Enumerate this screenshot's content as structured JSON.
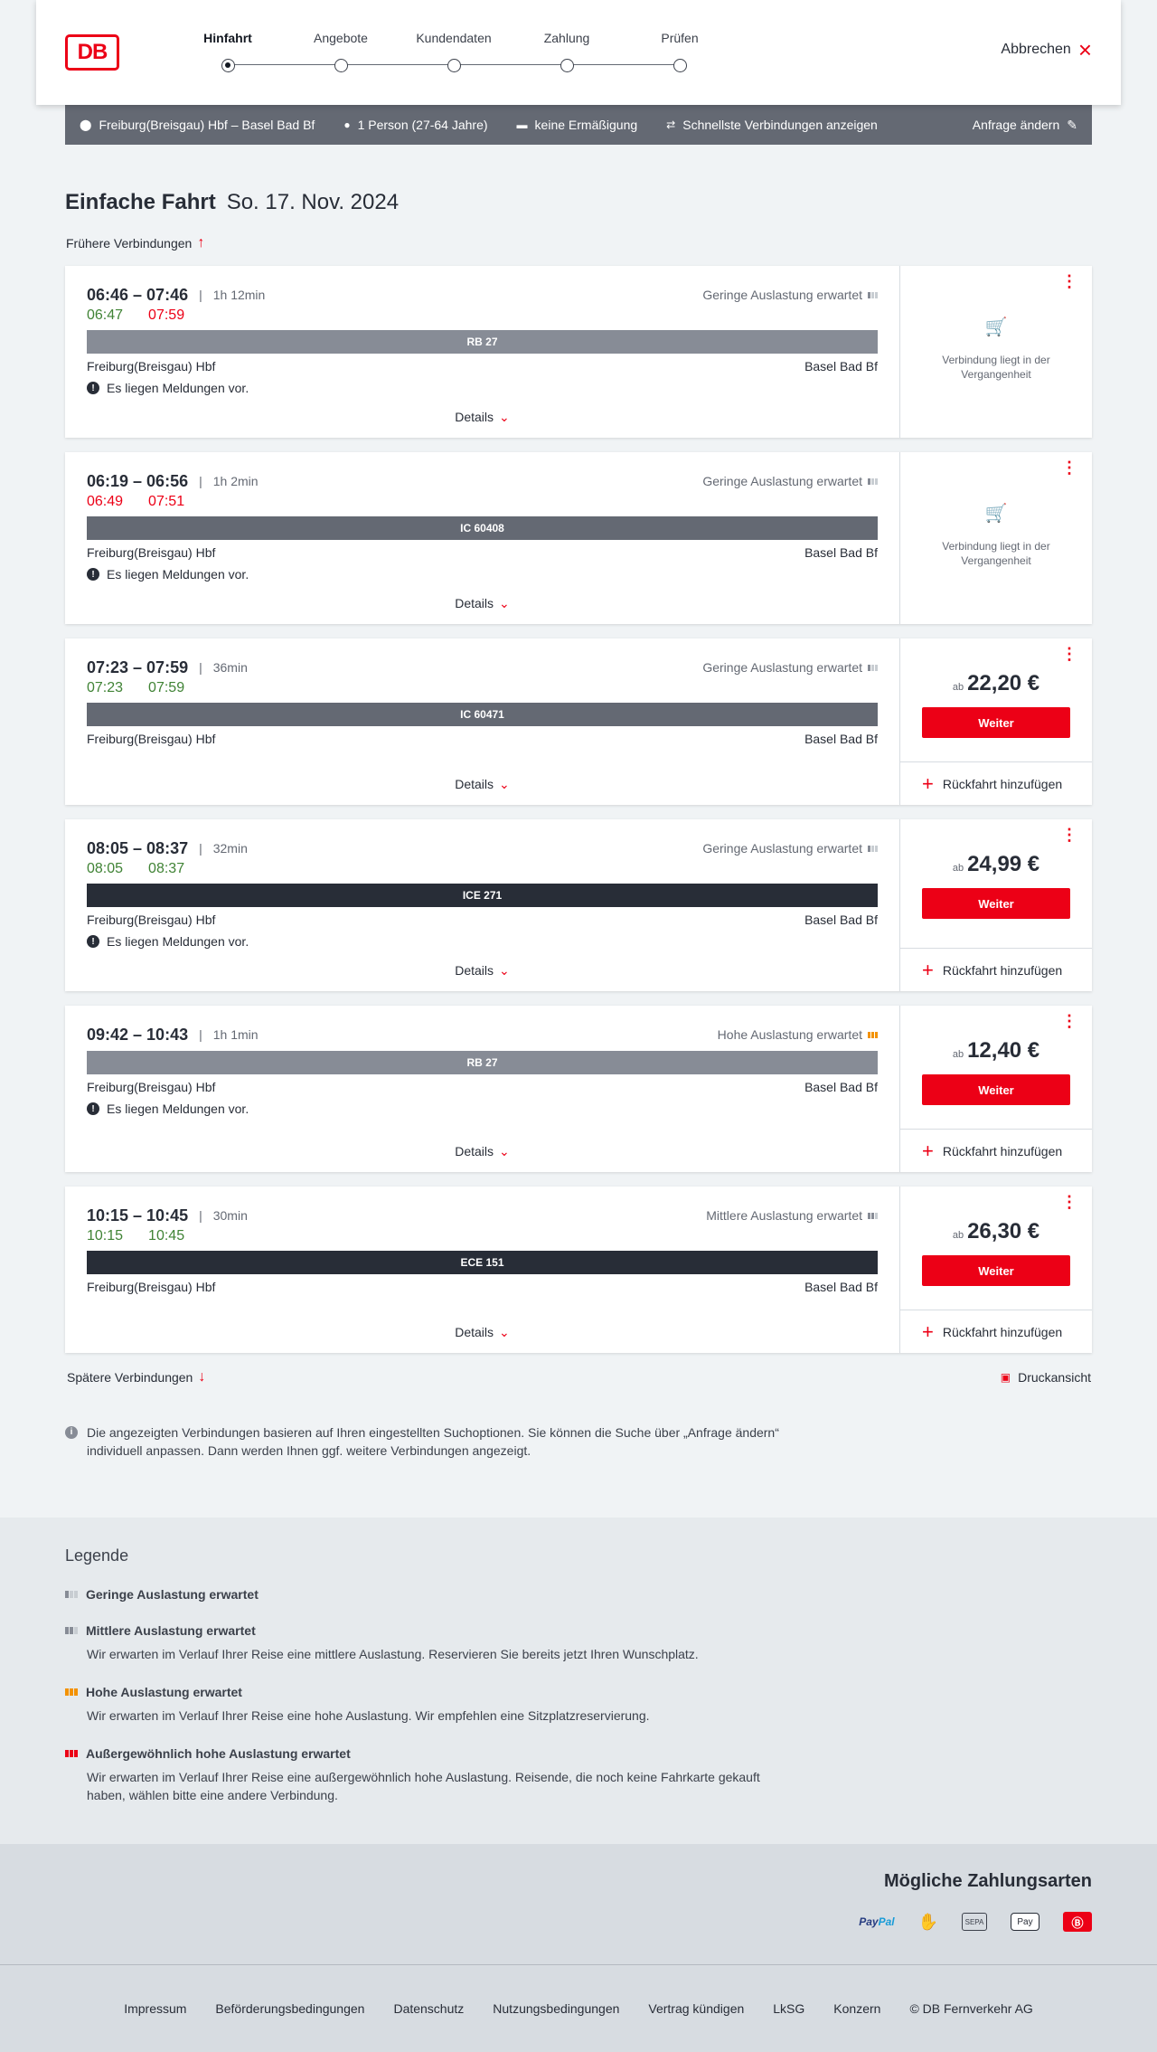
{
  "header": {
    "logo": "DB",
    "steps": [
      "Hinfahrt",
      "Angebote",
      "Kundendaten",
      "Zahlung",
      "Prüfen"
    ],
    "cancel": "Abbrechen"
  },
  "searchbar": {
    "route": "Freiburg(Breisgau) Hbf – Basel Bad Bf",
    "persons": "1 Person (27-64 Jahre)",
    "discount": "keine Ermäßigung",
    "fastest": "Schnellste Verbindungen anzeigen",
    "change": "Anfrage ändern"
  },
  "main": {
    "title": "Einfache Fahrt",
    "date": "So. 17. Nov. 2024",
    "earlier": "Frühere Verbindungen",
    "later": "Spätere Verbindungen",
    "print": "Druckansicht",
    "info": "Die angezeigten Verbindungen basieren auf Ihren eingestellten Suchoptionen. Sie können die Suche über „Anfrage ändern“ individuell anpassen. Dann werden Ihnen ggf. weitere Verbindungen angezeigt."
  },
  "common": {
    "details": "Details",
    "past": "Verbindung liegt in der Vergangenheit",
    "ab": "ab",
    "weiter": "Weiter",
    "return": "Rückfahrt hinzufügen",
    "messages": "Es liegen Meldungen vor."
  },
  "connections": [
    {
      "times": "06:46 – 07:46",
      "duration": "1h 12min",
      "load": "Geringe Auslastung erwartet",
      "rt_dep": "06:47",
      "rt_arr": "07:59",
      "train": "RB 27",
      "from": "Freiburg(Breisgau) Hbf",
      "to": "Basel Bad Bf"
    },
    {
      "times": "06:19 – 06:56",
      "duration": "1h 2min",
      "load": "Geringe Auslastung erwartet",
      "rt_dep": "06:49",
      "rt_arr": "07:51",
      "train": "IC 60408",
      "from": "Freiburg(Breisgau) Hbf",
      "to": "Basel Bad Bf"
    },
    {
      "times": "07:23 – 07:59",
      "duration": "36min",
      "load": "Geringe Auslastung erwartet",
      "rt_dep": "07:23",
      "rt_arr": "07:59",
      "train": "IC 60471",
      "from": "Freiburg(Breisgau) Hbf",
      "to": "Basel Bad Bf",
      "price": "22,20 €"
    },
    {
      "times": "08:05 – 08:37",
      "duration": "32min",
      "load": "Geringe Auslastung erwartet",
      "rt_dep": "08:05",
      "rt_arr": "08:37",
      "train": "ICE 271",
      "from": "Freiburg(Breisgau) Hbf",
      "to": "Basel Bad Bf",
      "price": "24,99 €"
    },
    {
      "times": "09:42 – 10:43",
      "duration": "1h 1min",
      "load": "Hohe Auslastung erwartet",
      "train": "RB 27",
      "from": "Freiburg(Breisgau) Hbf",
      "to": "Basel Bad Bf",
      "price": "12,40 €"
    },
    {
      "times": "10:15 – 10:45",
      "duration": "30min",
      "load": "Mittlere Auslastung erwartet",
      "rt_dep": "10:15",
      "rt_arr": "10:45",
      "train": "ECE 151",
      "from": "Freiburg(Breisgau) Hbf",
      "to": "Basel Bad Bf",
      "price": "26,30 €"
    }
  ],
  "legend": {
    "title": "Legende",
    "items": [
      {
        "title": "Geringe Auslastung erwartet",
        "desc": ""
      },
      {
        "title": "Mittlere Auslastung erwartet",
        "desc": "Wir erwarten im Verlauf Ihrer Reise eine mittlere Auslastung. Reservieren Sie bereits jetzt Ihren Wunschplatz."
      },
      {
        "title": "Hohe Auslastung erwartet",
        "desc": "Wir erwarten im Verlauf Ihrer Reise eine hohe Auslastung. Wir empfehlen eine Sitzplatzreservierung."
      },
      {
        "title": "Außergewöhnlich hohe Auslastung erwartet",
        "desc": "Wir erwarten im Verlauf Ihrer Reise eine außergewöhnlich hohe Auslastung. Reisende, die noch keine Fahrkarte gekauft haben, wählen bitte eine andere Verbindung."
      }
    ]
  },
  "payment": {
    "title": "Mögliche Zahlungsarten",
    "paypal_a": "Pay",
    "paypal_b": "Pal",
    "sepa": "SEPA",
    "applepay": "Pay"
  },
  "footer": [
    "Impressum",
    "Beförderungsbedingungen",
    "Datenschutz",
    "Nutzungsbedingungen",
    "Vertrag kündigen",
    "LkSG",
    "Konzern",
    "© DB Fernverkehr AG"
  ],
  "colors": {
    "brand": "#ec0016",
    "ok": "#408335",
    "load_high": "#f39200"
  }
}
